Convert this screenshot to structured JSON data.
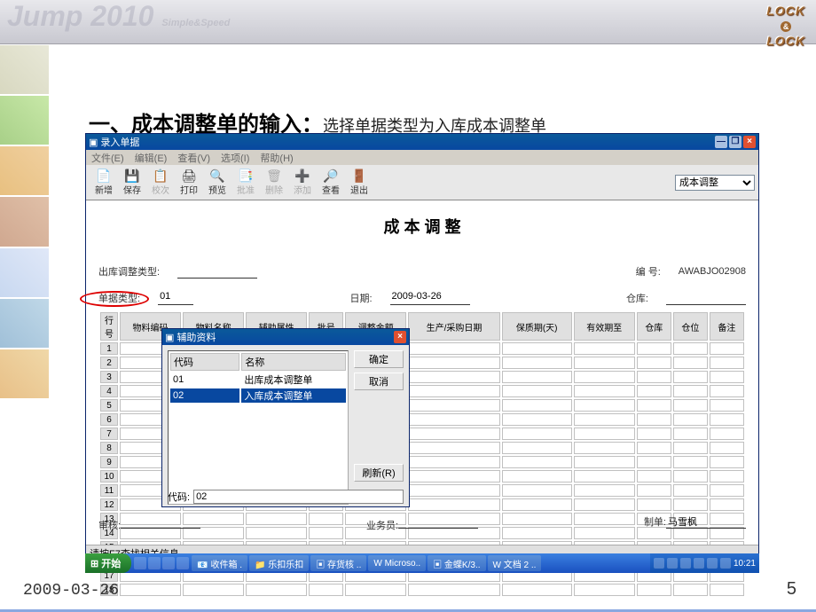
{
  "header": {
    "jump": "Jump 2010",
    "simple": "Simple&Speed",
    "logo_top": "LOCK",
    "logo_bot": "LOCK",
    "logo_amp": "&"
  },
  "slide": {
    "title_bold": "一、成本调整单的输入：",
    "title_rest": "选择单据类型为入库成本调整单",
    "date": "2009-03-26",
    "page": "5"
  },
  "main_win": {
    "title": "录入单据",
    "icon": "▣",
    "menu": [
      "文件(E)",
      "编辑(E)",
      "查看(V)",
      "选项(I)",
      "帮助(H)"
    ],
    "toolbar": [
      {
        "icon": "📄",
        "lbl": "新增",
        "en": true
      },
      {
        "icon": "💾",
        "lbl": "保存",
        "en": true
      },
      {
        "icon": "📋",
        "lbl": "校次",
        "en": false
      },
      {
        "icon": "🖨",
        "lbl": "打印",
        "en": true
      },
      {
        "icon": "🔍",
        "lbl": "预览",
        "en": true
      },
      {
        "icon": "📑",
        "lbl": "批准",
        "en": false
      },
      {
        "icon": "🗑",
        "lbl": "删除",
        "en": false
      },
      {
        "icon": "➕",
        "lbl": "添加",
        "en": false
      },
      {
        "icon": "🔎",
        "lbl": "查看",
        "en": true
      },
      {
        "icon": "🚪",
        "lbl": "退出",
        "en": true
      }
    ],
    "doc_type_sel": "成本调整",
    "doc_title": "成 本 调 整",
    "fields": {
      "out_adj_type": "出库调整类型:",
      "bill_no_lbl": "编    号:",
      "bill_no_val": "AWABJO02908",
      "doc_type_lbl": "单据类型:",
      "doc_type_val": "01",
      "date_lbl": "日期:",
      "date_val": "2009-03-26",
      "whse_lbl": "仓库:"
    },
    "grid_headers": [
      "行号",
      "物料编码",
      "物料名称",
      "辅助属性",
      "批号",
      "调整金额",
      "生产/采购日期",
      "保质期(天)",
      "有效期至",
      "仓库",
      "仓位",
      "备注"
    ],
    "rows": 18,
    "audit_lbl": "审核:",
    "sales_lbl": "业务员:",
    "maker_lbl": "制单:",
    "maker_val": "马雪枫",
    "status": "请按F7查找相关信息"
  },
  "popup": {
    "title": "辅助资料",
    "icon": "▣",
    "col1": "代码",
    "col2": "名称",
    "rows": [
      {
        "code": "01",
        "name": "出库成本调整单",
        "sel": false
      },
      {
        "code": "02",
        "name": "入库成本调整单",
        "sel": true
      }
    ],
    "btn_ok": "确定",
    "btn_cancel": "取消",
    "btn_refresh": "刷新(R)",
    "foot_lbl": "代码:",
    "foot_val": "02"
  },
  "taskbar": {
    "start": "开始",
    "items": [
      "📧 收件箱 .",
      "📁 乐扣乐扣",
      "▣ 存货核 ..",
      "W Microso..",
      "▣ 金蝶K/3..",
      "W 文档 2 .."
    ],
    "clock": "10:21"
  }
}
